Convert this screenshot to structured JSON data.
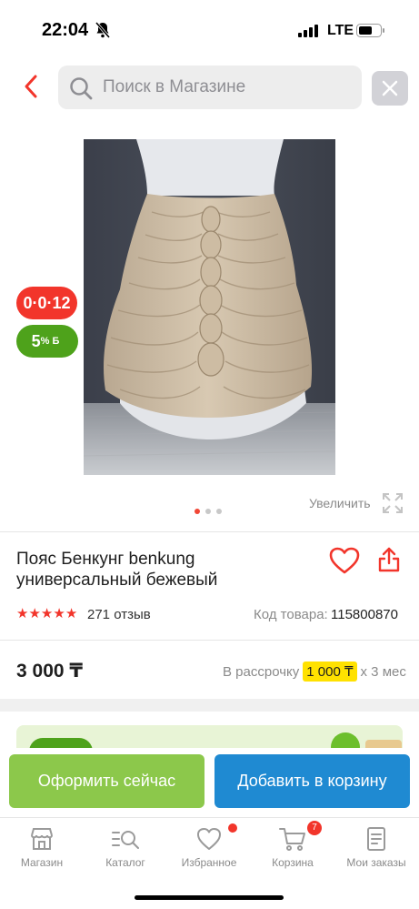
{
  "status_bar": {
    "time": "22:04",
    "network": "LTE"
  },
  "search": {
    "placeholder": "Поиск в Магазине"
  },
  "product": {
    "image_alt": "beige-ruched-belt-on-mannequin",
    "badges": {
      "installment": "0·0·12",
      "bonus_value": "5",
      "bonus_unit": "% Б"
    },
    "gallery": {
      "total_images": 3,
      "active_index": 0,
      "zoom_label": "Увеличить"
    },
    "title": "Пояс Бенкунг benkung универсальный бежевый",
    "rating": 5,
    "reviews": "271 отзыв",
    "sku_label": "Код товара:",
    "sku_value": "115800870",
    "price": "3 000 ₸",
    "installment_prefix": "В рассрочку",
    "installment_amount": "1 000 ₸",
    "installment_suffix": "x 3 мес"
  },
  "actions": {
    "checkout": "Оформить сейчас",
    "add_to_cart": "Добавить в корзину"
  },
  "tabs": [
    {
      "label": "Магазин",
      "icon": "shop-icon"
    },
    {
      "label": "Каталог",
      "icon": "catalog-icon"
    },
    {
      "label": "Избранное",
      "icon": "heart-icon"
    },
    {
      "label": "Корзина",
      "icon": "cart-icon"
    },
    {
      "label": "Мои заказы",
      "icon": "orders-icon"
    }
  ],
  "cart_count": "7",
  "colors": {
    "accent_red": "#f2352b",
    "green": "#8cc84b",
    "blue": "#1f8ad2",
    "installment_yellow": "#ffe100"
  }
}
